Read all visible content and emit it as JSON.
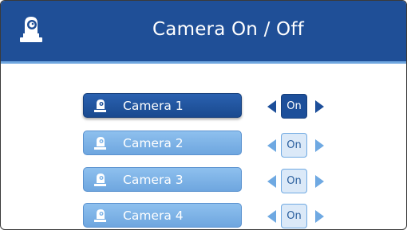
{
  "header": {
    "title": "Camera  On / Off",
    "icon": "ptz-camera-icon"
  },
  "colors": {
    "header_bg": "#1f4f97",
    "active_button": "#1d4f9a",
    "inactive_button": "#7db3e7"
  },
  "cameras": [
    {
      "label": "Camera 1",
      "state": "On",
      "selected": true,
      "icon": "camera-icon"
    },
    {
      "label": "Camera 2",
      "state": "On",
      "selected": false,
      "icon": "camera-icon"
    },
    {
      "label": "Camera 3",
      "state": "On",
      "selected": false,
      "icon": "camera-icon"
    },
    {
      "label": "Camera 4",
      "state": "On",
      "selected": false,
      "icon": "camera-icon"
    }
  ]
}
